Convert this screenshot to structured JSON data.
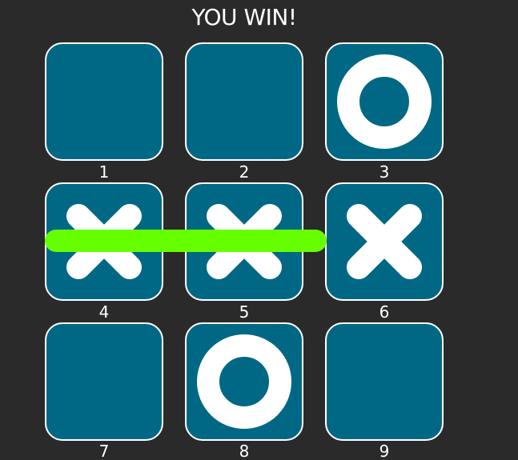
{
  "status": {
    "message": "YOU WIN!"
  },
  "board": {
    "cells": [
      {
        "label": "1",
        "mark": ""
      },
      {
        "label": "2",
        "mark": ""
      },
      {
        "label": "3",
        "mark": "O"
      },
      {
        "label": "4",
        "mark": "X"
      },
      {
        "label": "5",
        "mark": "X"
      },
      {
        "label": "6",
        "mark": "X"
      },
      {
        "label": "7",
        "mark": ""
      },
      {
        "label": "8",
        "mark": "O"
      },
      {
        "label": "9",
        "mark": ""
      }
    ],
    "winning_cells": [
      "4",
      "5",
      "6"
    ]
  },
  "colors": {
    "background": "#2a2a2a",
    "cell_fill": "#006884",
    "cell_border": "#ffffff",
    "mark": "#ffffff",
    "win_line": "#66ff00"
  },
  "icons": {
    "x_mark": "x-mark-icon",
    "o_mark": "o-mark-icon"
  }
}
